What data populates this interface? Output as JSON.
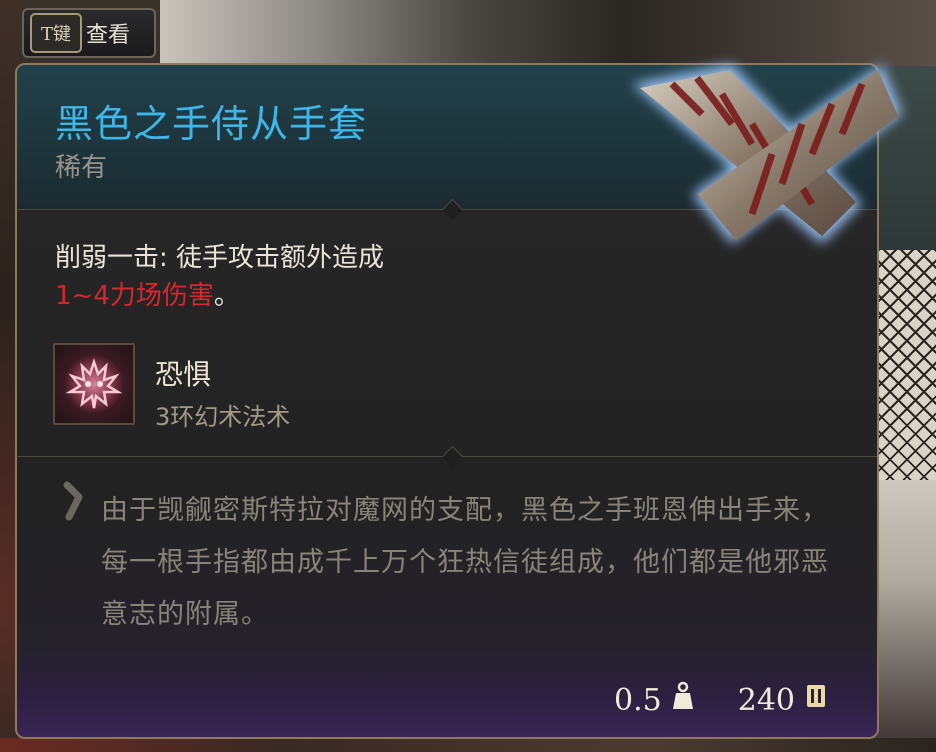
{
  "key_hint": {
    "key": "T键",
    "label": "查看"
  },
  "item": {
    "name": "黑色之手侍从手套",
    "rarity": "稀有",
    "effect_text": "削弱一击: 徒手攻击额外造成",
    "effect_damage": "1~4力场伤害",
    "effect_end": "。",
    "spell": {
      "name": "恐惧",
      "level": "3环幻术法术",
      "icon": "fear-spell-icon"
    },
    "flavor_text": "由于觊觎密斯特拉对魔网的支配，黑色之手班恩伸出手来，每一根手指都由成千上万个狂热信徒组成，他们都是他邪恶意志的附属。",
    "weight": "0.5",
    "weight_icon": "weight-icon",
    "value": "240",
    "value_icon": "gold-coin-icon"
  },
  "colors": {
    "name": "#3fb6e8",
    "damage": "#d8262e",
    "border": "#8c7a5c"
  }
}
